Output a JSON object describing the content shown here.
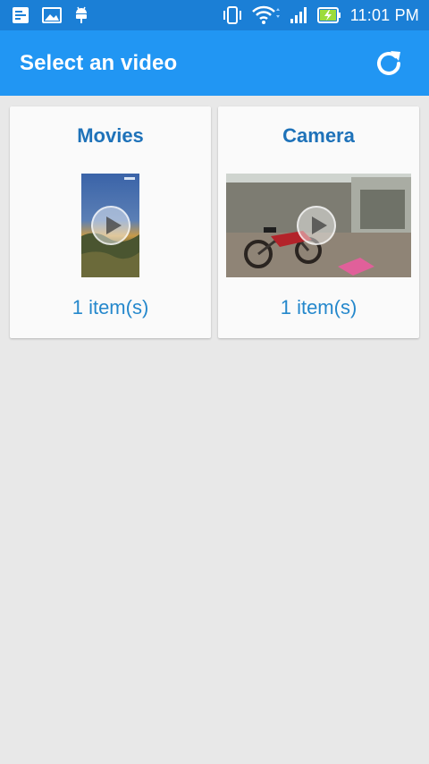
{
  "status_bar": {
    "time": "11:01 PM",
    "left_icons": [
      "screenshot-icon",
      "gallery-icon",
      "android-debug-icon"
    ],
    "right_icons": [
      "vibrate-icon",
      "wifi-icon",
      "signal-icon",
      "battery-charging-icon"
    ]
  },
  "app_bar": {
    "title": "Select an video",
    "action_icon": "refresh-icon"
  },
  "albums": [
    {
      "name": "Movies",
      "count": "1 item(s)"
    },
    {
      "name": "Camera",
      "count": "1 item(s)"
    }
  ],
  "colors": {
    "status_bar": "#1b7fd6",
    "app_bar": "#2196f3",
    "background": "#e8e8e8",
    "card": "#fafafa",
    "album_name": "#1e72b9",
    "album_count": "#2588cc"
  }
}
